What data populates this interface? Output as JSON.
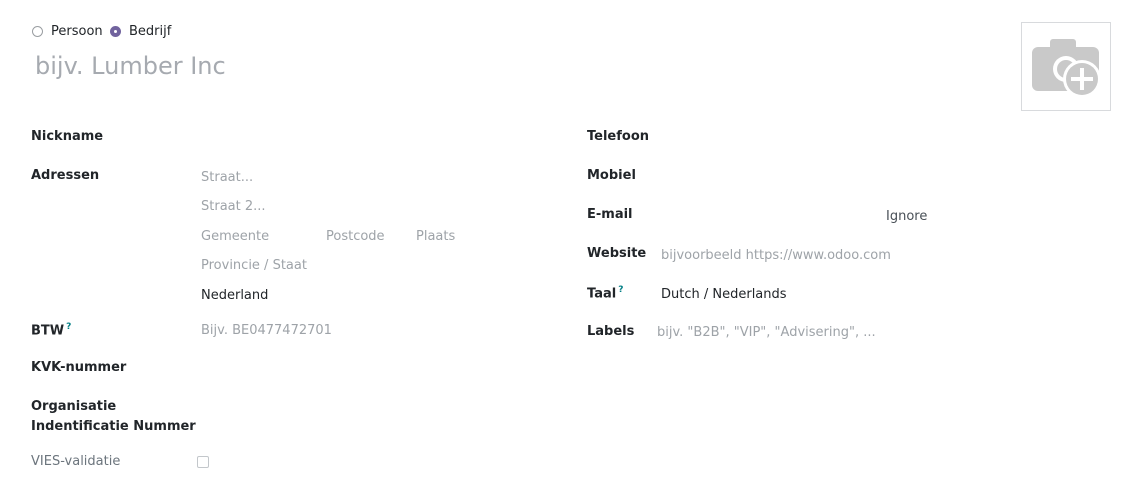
{
  "company_type": {
    "person_label": "Persoon",
    "company_label": "Bedrijf",
    "selected": "company"
  },
  "name": {
    "placeholder": "bijv. Lumber Inc"
  },
  "left_fields": {
    "nickname_label": "Nickname",
    "addresses_label": "Adressen",
    "street_placeholder": "Straat...",
    "street2_placeholder": "Straat 2...",
    "city_placeholder": "Gemeente",
    "zip_placeholder": "Postcode",
    "place_placeholder": "Plaats",
    "state_placeholder": "Provincie / Staat",
    "country_value": "Nederland",
    "vat_label": "BTW",
    "vat_help": "?",
    "vat_placeholder": "Bijv.  BE0477472701",
    "kvk_label": "KVK-nummer",
    "org_label_line1": "Organisatie",
    "org_label_line2": "Indentificatie Nummer",
    "vies_label": "VIES-validatie"
  },
  "right_fields": {
    "phone_label": "Telefoon",
    "mobile_label": "Mobiel",
    "email_label": "E-mail",
    "email_ignore": "Ignore",
    "website_label": "Website",
    "website_placeholder": "bijvoorbeeld https://www.odoo.com",
    "lang_label": "Taal",
    "lang_help": "?",
    "lang_value": "Dutch / Nederlands",
    "labels_label": "Labels",
    "labels_placeholder": "bijv. \"B2B\", \"VIP\", \"Advisering\", ..."
  },
  "avatar": {
    "icon": "camera-plus-icon"
  }
}
